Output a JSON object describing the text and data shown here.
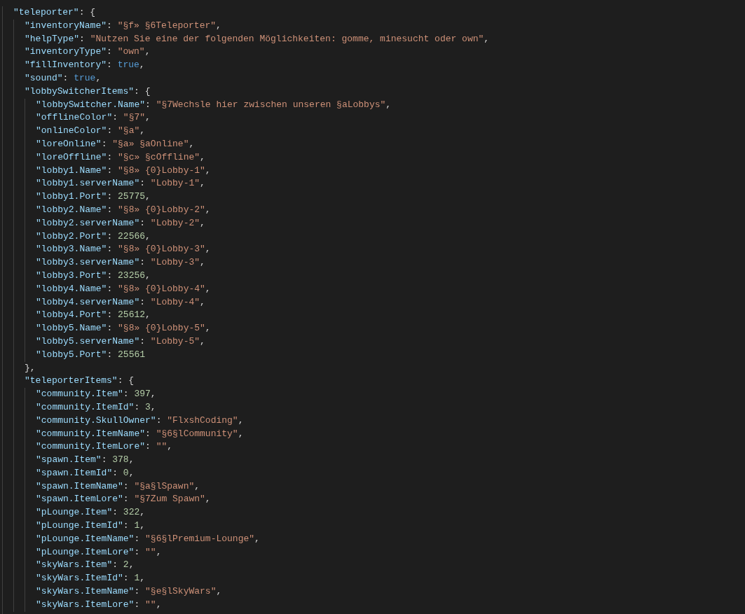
{
  "editor": {
    "lines": [
      {
        "key": "\"teleporter\"",
        "sep": ":",
        "value": "{",
        "kind": "brace",
        "children": [
          {
            "key": "\"inventoryName\"",
            "sep": ":",
            "value": "\"§f» §6Teleporter\"",
            "kind": "string",
            "trail": ","
          },
          {
            "key": "\"helpType\"",
            "sep": ":",
            "value": "\"Nutzen Sie eine der folgenden Möglichkeiten: gomme, minesucht oder own\"",
            "kind": "string",
            "trail": ","
          },
          {
            "key": "\"inventoryType\"",
            "sep": ":",
            "value": "\"own\"",
            "kind": "string",
            "trail": ","
          },
          {
            "key": "\"fillInventory\"",
            "sep": ":",
            "value": "true",
            "kind": "boolean",
            "trail": ","
          },
          {
            "key": "\"sound\"",
            "sep": ":",
            "value": "true",
            "kind": "boolean",
            "trail": ","
          },
          {
            "key": "\"lobbySwitcherItems\"",
            "sep": ":",
            "value": "{",
            "kind": "brace",
            "close": "},",
            "children": [
              {
                "key": "\"lobbySwitcher.Name\"",
                "sep": ":",
                "value": "\"§7Wechsle hier zwischen unseren §aLobbys\"",
                "kind": "string",
                "trail": ","
              },
              {
                "key": "\"offlineColor\"",
                "sep": ":",
                "value": "\"§7\"",
                "kind": "string",
                "trail": ","
              },
              {
                "key": "\"onlineColor\"",
                "sep": ":",
                "value": "\"§a\"",
                "kind": "string",
                "trail": ","
              },
              {
                "key": "\"loreOnline\"",
                "sep": ":",
                "value": "\"§a» §aOnline\"",
                "kind": "string",
                "trail": ","
              },
              {
                "key": "\"loreOffline\"",
                "sep": ":",
                "value": "\"§c» §cOffline\"",
                "kind": "string",
                "trail": ","
              },
              {
                "key": "\"lobby1.Name\"",
                "sep": ":",
                "value": "\"§8» {0}Lobby-1\"",
                "kind": "string",
                "trail": ","
              },
              {
                "key": "\"lobby1.serverName\"",
                "sep": ":",
                "value": "\"Lobby-1\"",
                "kind": "string",
                "trail": ","
              },
              {
                "key": "\"lobby1.Port\"",
                "sep": ":",
                "value": "25775",
                "kind": "number",
                "trail": ","
              },
              {
                "key": "\"lobby2.Name\"",
                "sep": ":",
                "value": "\"§8» {0}Lobby-2\"",
                "kind": "string",
                "trail": ","
              },
              {
                "key": "\"lobby2.serverName\"",
                "sep": ":",
                "value": "\"Lobby-2\"",
                "kind": "string",
                "trail": ","
              },
              {
                "key": "\"lobby2.Port\"",
                "sep": ":",
                "value": "22566",
                "kind": "number",
                "trail": ","
              },
              {
                "key": "\"lobby3.Name\"",
                "sep": ":",
                "value": "\"§8» {0}Lobby-3\"",
                "kind": "string",
                "trail": ","
              },
              {
                "key": "\"lobby3.serverName\"",
                "sep": ":",
                "value": "\"Lobby-3\"",
                "kind": "string",
                "trail": ","
              },
              {
                "key": "\"lobby3.Port\"",
                "sep": ":",
                "value": "23256",
                "kind": "number",
                "trail": ","
              },
              {
                "key": "\"lobby4.Name\"",
                "sep": ":",
                "value": "\"§8» {0}Lobby-4\"",
                "kind": "string",
                "trail": ","
              },
              {
                "key": "\"lobby4.serverName\"",
                "sep": ":",
                "value": "\"Lobby-4\"",
                "kind": "string",
                "trail": ","
              },
              {
                "key": "\"lobby4.Port\"",
                "sep": ":",
                "value": "25612",
                "kind": "number",
                "trail": ","
              },
              {
                "key": "\"lobby5.Name\"",
                "sep": ":",
                "value": "\"§8» {0}Lobby-5\"",
                "kind": "string",
                "trail": ","
              },
              {
                "key": "\"lobby5.serverName\"",
                "sep": ":",
                "value": "\"Lobby-5\"",
                "kind": "string",
                "trail": ","
              },
              {
                "key": "\"lobby5.Port\"",
                "sep": ":",
                "value": "25561",
                "kind": "number"
              }
            ]
          },
          {
            "key": "\"teleporterItems\"",
            "sep": ":",
            "value": "{",
            "kind": "brace",
            "children": [
              {
                "key": "\"community.Item\"",
                "sep": ":",
                "value": "397",
                "kind": "number",
                "trail": ","
              },
              {
                "key": "\"community.ItemId\"",
                "sep": ":",
                "value": "3",
                "kind": "number",
                "trail": ","
              },
              {
                "key": "\"community.SkullOwner\"",
                "sep": ":",
                "value": "\"FlxshCoding\"",
                "kind": "string",
                "trail": ","
              },
              {
                "key": "\"community.ItemName\"",
                "sep": ":",
                "value": "\"§6§lCommunity\"",
                "kind": "string",
                "trail": ","
              },
              {
                "key": "\"community.ItemLore\"",
                "sep": ":",
                "value": "\"\"",
                "kind": "string",
                "trail": ","
              },
              {
                "key": "\"spawn.Item\"",
                "sep": ":",
                "value": "378",
                "kind": "number",
                "trail": ","
              },
              {
                "key": "\"spawn.ItemId\"",
                "sep": ":",
                "value": "0",
                "kind": "number",
                "trail": ","
              },
              {
                "key": "\"spawn.ItemName\"",
                "sep": ":",
                "value": "\"§a§lSpawn\"",
                "kind": "string",
                "trail": ","
              },
              {
                "key": "\"spawn.ItemLore\"",
                "sep": ":",
                "value": "\"§7Zum Spawn\"",
                "kind": "string",
                "trail": ","
              },
              {
                "key": "\"pLounge.Item\"",
                "sep": ":",
                "value": "322",
                "kind": "number",
                "trail": ","
              },
              {
                "key": "\"pLounge.ItemId\"",
                "sep": ":",
                "value": "1",
                "kind": "number",
                "trail": ","
              },
              {
                "key": "\"pLounge.ItemName\"",
                "sep": ":",
                "value": "\"§6§lPremium-Lounge\"",
                "kind": "string",
                "trail": ","
              },
              {
                "key": "\"pLounge.ItemLore\"",
                "sep": ":",
                "value": "\"\"",
                "kind": "string",
                "trail": ","
              },
              {
                "key": "\"skyWars.Item\"",
                "sep": ":",
                "value": "2",
                "kind": "number",
                "trail": ","
              },
              {
                "key": "\"skyWars.ItemId\"",
                "sep": ":",
                "value": "1",
                "kind": "number",
                "trail": ","
              },
              {
                "key": "\"skyWars.ItemName\"",
                "sep": ":",
                "value": "\"§e§lSkyWars\"",
                "kind": "string",
                "trail": ","
              },
              {
                "key": "\"skyWars.ItemLore\"",
                "sep": ":",
                "value": "\"\"",
                "kind": "string",
                "trail": ","
              }
            ]
          }
        ]
      }
    ]
  }
}
